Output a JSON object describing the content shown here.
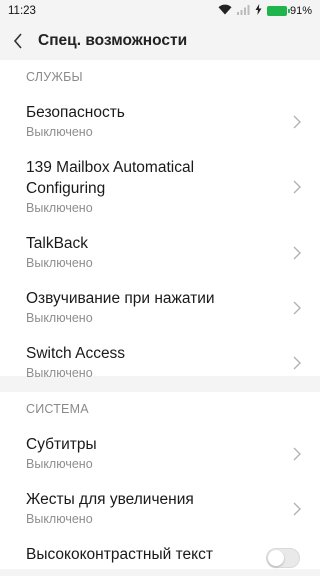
{
  "status_bar": {
    "time": "11:23",
    "battery_level": "91%",
    "icons": [
      "wifi-icon",
      "signal-icon",
      "charging-icon",
      "battery-icon"
    ],
    "battery_color": "#1fb54c"
  },
  "header": {
    "title": "Спец. возможности",
    "back_icon": "back-arrow-icon"
  },
  "sections": [
    {
      "header": "СЛУЖБЫ",
      "items": [
        {
          "title": "Безопасность",
          "status": "Выключено"
        },
        {
          "title_line1": "139 Mailbox Automatical",
          "title_line2": "Configuring",
          "status": "Выключено"
        },
        {
          "title": "TalkBack",
          "status": "Выключено"
        },
        {
          "title": "Озвучивание при нажатии",
          "status": "Выключено"
        },
        {
          "title": "Switch Access",
          "status": "Выключено"
        }
      ]
    },
    {
      "header": "СИСТЕМА",
      "items": [
        {
          "title": "Субтитры",
          "status": "Выключено"
        },
        {
          "title": "Жесты для увеличения",
          "status": "Выключено"
        },
        {
          "title": "Высококонтрастный текст",
          "toggle": "off"
        }
      ]
    }
  ]
}
